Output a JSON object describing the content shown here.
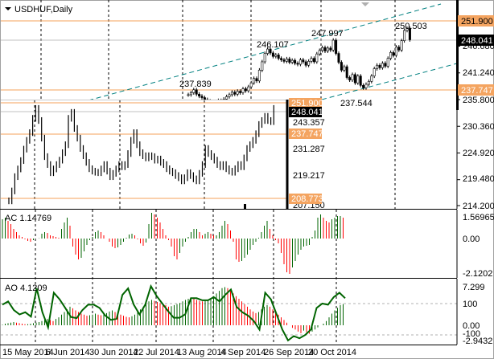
{
  "window": {
    "symbol_title": "USDHUF,Daily"
  },
  "colors": {
    "orange": "#f4a460",
    "line_orange": "#f5a05a",
    "channel": "#008080",
    "up": "#006400",
    "down": "#ff0000",
    "grid": "#000000"
  },
  "main": {
    "axis_labels": [
      "246.680",
      "241.240",
      "235.800",
      "230.360",
      "224.920",
      "219.480",
      "214.200"
    ],
    "axis_values": [
      246.68,
      241.24,
      235.8,
      230.36,
      224.92,
      219.48,
      214.2
    ],
    "level_high": "251.900",
    "level_current": "248.041",
    "level_low": "237.747",
    "annotations": [
      "237.839",
      "246.107",
      "247.997",
      "250.503",
      "237.544"
    ],
    "closes": [
      236.8,
      237.2,
      237.8,
      236.9,
      236.5,
      236.2,
      235.8,
      235.5,
      235.3,
      235.0,
      235.2,
      235.6,
      235.4,
      235.9,
      236.4,
      236.8,
      237.3,
      236.9,
      237.5,
      237.2,
      238.0,
      237.6,
      238.4,
      239.2,
      240.1,
      239.6,
      241.8,
      243.5,
      245.2,
      246.1,
      245.3,
      244.6,
      244.9,
      244.2,
      243.9,
      243.6,
      244.1,
      243.4,
      243.8,
      243.2,
      243.0,
      243.9,
      243.5,
      242.8,
      243.6,
      244.2,
      243.5,
      245.1,
      245.8,
      246.4,
      245.7,
      246.3,
      245.9,
      247.9,
      245.2,
      243.4,
      241.8,
      242.5,
      240.3,
      239.8,
      240.9,
      239.2,
      240.6,
      238.7,
      238.2,
      238.9,
      239.5,
      240.6,
      242.1,
      242.8,
      242.3,
      243.2,
      242.6,
      244.2,
      245.4,
      244.8,
      246.5,
      245.9,
      247.8,
      249.9,
      250.3,
      248.0
    ]
  },
  "inset": {
    "axis_labels": [
      "243.357",
      "231.287",
      "219.217",
      "207.150"
    ],
    "level_high": "251.900",
    "level_current": "248.041",
    "level_mid": "237.747",
    "level_low": "208.773",
    "closes": [
      207.5,
      212,
      218.5,
      222,
      225.8,
      231,
      235,
      238.5,
      245,
      249.5,
      244,
      236,
      227.6,
      224,
      220.3,
      222,
      224,
      226,
      229.4,
      233,
      245,
      247.7,
      240.4,
      236,
      231.3,
      228,
      225,
      222.1,
      221,
      220.5,
      220.3,
      222,
      224,
      221,
      218.5,
      220,
      222,
      224,
      223,
      224,
      229,
      235,
      238.5,
      233,
      229.4,
      228,
      227,
      228,
      227.6,
      226,
      226.5,
      225,
      224,
      222.1,
      221,
      220.3,
      219,
      218,
      216.6,
      218,
      220.3,
      219,
      217.5,
      216.6,
      220,
      224,
      231.3,
      229,
      227.6,
      226,
      224,
      223,
      224,
      222.1,
      221,
      220.5,
      222.1,
      224,
      223,
      227,
      231.3,
      233,
      235,
      238,
      242.2,
      244,
      245.9,
      244,
      243.5,
      249.5
    ]
  },
  "ac": {
    "label": "AC 1.14769",
    "axis_labels": [
      "1.56965",
      "0.00",
      "-2.1202"
    ],
    "values": [
      1.2,
      1.3,
      1.1,
      0.9,
      0.6,
      0.4,
      0.2,
      0.1,
      -0.05,
      -0.15,
      -0.2,
      -0.1,
      0,
      0.02,
      0.3,
      0.4,
      0.35,
      0.2,
      0.15,
      0.1,
      0.05,
      0.6,
      1.0,
      1.3,
      0.8,
      -0.5,
      -1.0,
      -1.3,
      -1.2,
      -0.8,
      -0.4,
      -0.1,
      0.1,
      0.4,
      0.5,
      0.4,
      0.2,
      0,
      -0.2,
      -0.5,
      -0.6,
      -0.55,
      -0.4,
      -0.2,
      0.05,
      0.25,
      0.3,
      0.2,
      -0.05,
      -0.3,
      -0.45,
      -0.25,
      0.9,
      1.6,
      1.5,
      1.3,
      1.0,
      0.6,
      0.2,
      -0.1,
      -0.5,
      -1.1,
      -1.3,
      -0.9,
      -0.5,
      -0.2,
      0.1,
      0.4,
      0.6,
      0.6,
      0.4,
      0.2,
      0.3,
      0.4,
      0.3,
      0.2,
      0.2,
      0.4,
      0.8,
      1.1,
      0.9,
      0.5,
      -0.2,
      -1.3,
      -1.45,
      -1.4,
      -1.2,
      -1.0,
      -0.7,
      -0.4,
      -0.2,
      0.05,
      0.4,
      0.8,
      1.1,
      0.6,
      0.2,
      -0.1,
      -0.3,
      -0.9,
      -1.6,
      -2.1,
      -2.2,
      -1.8,
      -1.4,
      -1.0,
      -0.7,
      -0.5,
      -0.45,
      -0.4,
      0.1,
      0.5,
      1.3,
      1.5,
      1.3,
      1.1,
      1.0,
      1.2,
      1.3,
      1.4,
      1.4,
      1.3
    ]
  },
  "ao": {
    "label": "AO 4.1209",
    "axis_labels": [
      "7.299",
      "100",
      "0.00",
      "-100",
      "-2.9432"
    ],
    "values": [
      0.1,
      0.3,
      0.4,
      0.5,
      0.6,
      0.5,
      0.4,
      0.3,
      0.2,
      0.2,
      0.3,
      0.4,
      0.5,
      0.6,
      0.8,
      1.0,
      1.2,
      1.0,
      0.8,
      1.2,
      1.5,
      2.0,
      2.5,
      3.0,
      3.5,
      3.2,
      2.8,
      2.5,
      2.2,
      2.0,
      1.8,
      1.9,
      2.0,
      2.2,
      2.0,
      1.9,
      2.1,
      2.3,
      2.6,
      2.8,
      2.5,
      2.2,
      2.0,
      1.8,
      1.6,
      1.5,
      1.7,
      2.0,
      2.5,
      3.0,
      3.5,
      4.0,
      4.5,
      4.8,
      4.6,
      4.4,
      4.2,
      4.0,
      3.8,
      3.5,
      3.6,
      3.8,
      4.0,
      4.2,
      4.5,
      4.8,
      5.0,
      5.2,
      5.0,
      4.8,
      4.6,
      4.5,
      4.6,
      4.8,
      5.0,
      5.5,
      6.0,
      6.5,
      7.0,
      7.2,
      7.0,
      6.6,
      6.0,
      5.5,
      5.0,
      4.5,
      4.0,
      3.5,
      3.0,
      2.6,
      2.3,
      2.5,
      3.0,
      3.5,
      3.8,
      3.5,
      3.0,
      2.5,
      2.0,
      1.5,
      1.0,
      0.5,
      0,
      -0.5,
      -0.8,
      -1.2,
      -1.5,
      -1.0,
      -1.3,
      -1.6,
      -1.2,
      -0.8,
      -0.4,
      0,
      0.3,
      0.8,
      1.5,
      2.2,
      2.8,
      3.3,
      3.8,
      4.0
    ],
    "oscillator_line": [
      95,
      110,
      70,
      50,
      60,
      40,
      170,
      60,
      -10,
      150,
      120,
      80,
      38,
      33,
      70,
      95,
      95,
      80,
      45,
      25,
      30,
      140,
      170,
      95,
      50,
      95,
      180,
      135,
      100,
      65,
      35,
      35,
      50,
      125,
      125,
      115,
      115,
      130,
      110,
      140,
      165,
      85,
      60,
      45,
      20,
      -20,
      150,
      120,
      50,
      -20,
      -70,
      -50,
      -60,
      -45,
      -20,
      80,
      100,
      95,
      130,
      150,
      125
    ]
  },
  "time_axis": [
    "15 May 2014",
    "6 Jun 2014",
    "30 Jun 2014",
    "22 Jul 2014",
    "13 Aug 2014",
    "4 Sep 2014",
    "26 Sep 2014",
    "20 Oct 2014"
  ]
}
